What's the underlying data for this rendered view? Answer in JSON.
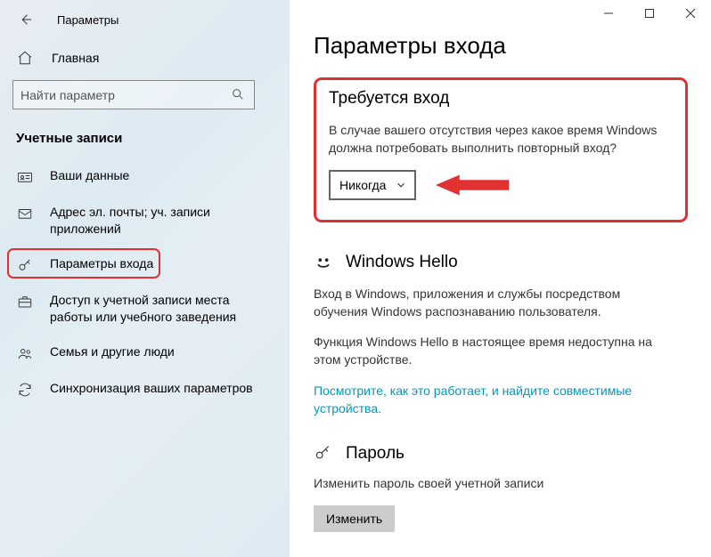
{
  "titlebar": {
    "title": "Параметры"
  },
  "home_label": "Главная",
  "search": {
    "placeholder": "Найти параметр"
  },
  "section": "Учетные записи",
  "nav": [
    {
      "label": "Ваши данные"
    },
    {
      "label": "Адрес эл. почты; уч. записи приложений"
    },
    {
      "label": "Параметры входа"
    },
    {
      "label": "Доступ к учетной записи места работы или учебного заведения"
    },
    {
      "label": "Семья и другие люди"
    },
    {
      "label": "Синхронизация ваших параметров"
    }
  ],
  "page_title": "Параметры входа",
  "signin": {
    "heading": "Требуется вход",
    "body": "В случае вашего отсутствия через какое время Windows должна потребовать выполнить повторный вход?",
    "value": "Никогда"
  },
  "hello": {
    "title": "Windows Hello",
    "body1": "Вход в Windows, приложения и службы посредством обучения Windows распознаванию пользователя.",
    "body2": "Функция Windows Hello в настоящее время недоступна на этом устройстве.",
    "link": "Посмотрите, как это работает, и найдите совместимые устройства."
  },
  "password": {
    "title": "Пароль",
    "body": "Изменить пароль своей учетной записи",
    "button": "Изменить"
  }
}
